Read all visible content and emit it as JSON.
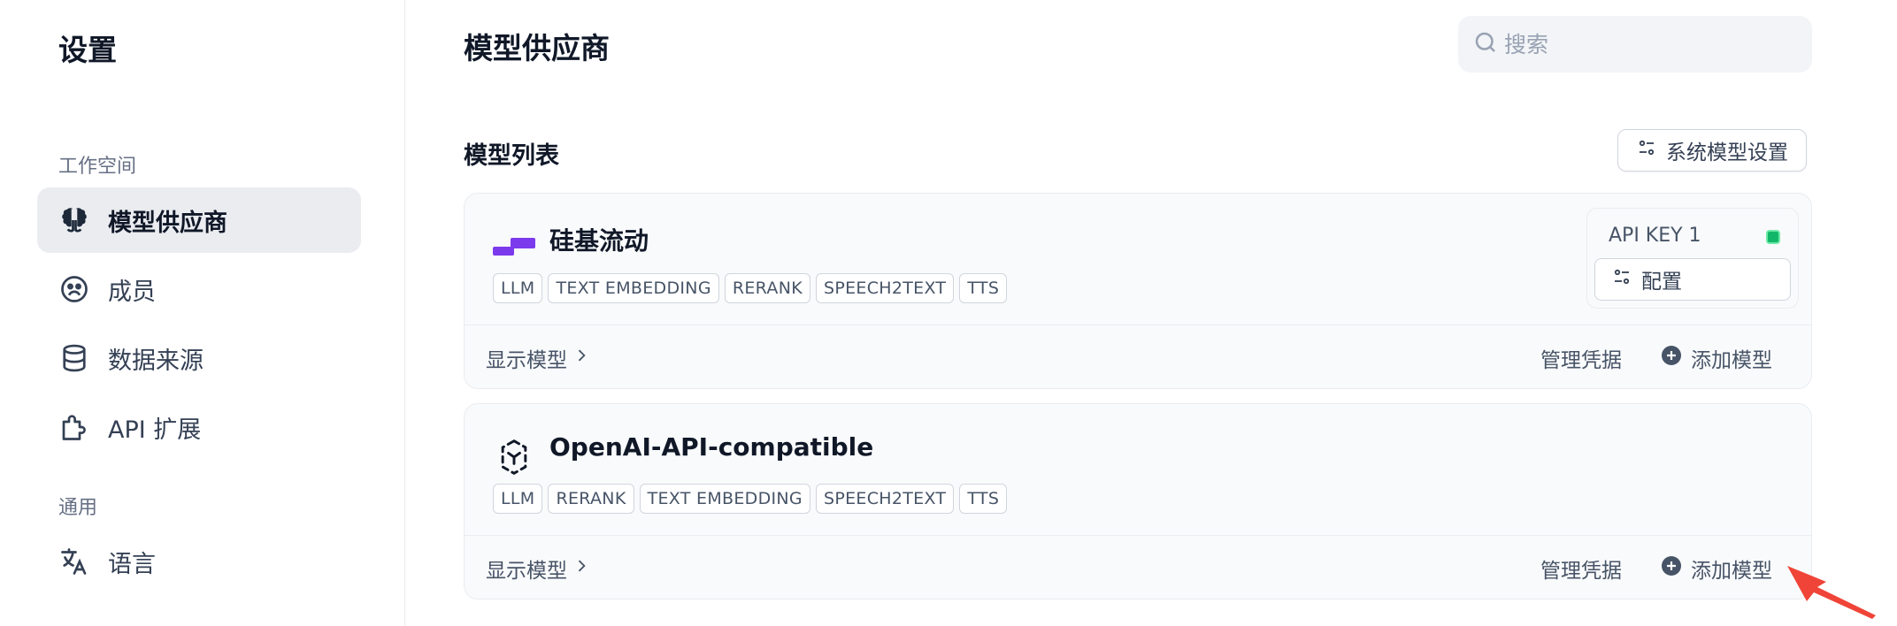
{
  "sidebar": {
    "title": "设置",
    "sections": [
      {
        "label": "工作空间",
        "items": [
          {
            "label": "模型供应商",
            "icon": "brain-icon",
            "active": true
          },
          {
            "label": "成员",
            "icon": "members-icon",
            "active": false
          },
          {
            "label": "数据来源",
            "icon": "database-icon",
            "active": false
          },
          {
            "label": "API 扩展",
            "icon": "puzzle-icon",
            "active": false
          }
        ]
      },
      {
        "label": "通用",
        "items": [
          {
            "label": "语言",
            "icon": "translate-icon",
            "active": false
          }
        ]
      }
    ]
  },
  "header": {
    "title": "模型供应商",
    "search": {
      "placeholder": "搜索",
      "value": ""
    }
  },
  "model_list": {
    "title": "模型列表",
    "system_settings_label": "系统模型设置",
    "providers": [
      {
        "name": "硅基流动",
        "logo": "siliconflow-logo-icon",
        "tags": [
          "LLM",
          "TEXT EMBEDDING",
          "RERANK",
          "SPEECH2TEXT",
          "TTS"
        ],
        "api_key_label": "API KEY 1",
        "api_key_status": "active",
        "config_label": "配置",
        "show_models_label": "显示模型",
        "manage_credentials_label": "管理凭据",
        "add_model_label": "添加模型"
      },
      {
        "name": "OpenAI-API-compatible",
        "logo": "openai-compatible-logo-icon",
        "tags": [
          "LLM",
          "RERANK",
          "TEXT EMBEDDING",
          "SPEECH2TEXT",
          "TTS"
        ],
        "show_models_label": "显示模型",
        "manage_credentials_label": "管理凭据",
        "add_model_label": "添加模型"
      }
    ]
  },
  "colors": {
    "accent": "#7c3aed",
    "status_green": "#12b76a",
    "annotation_arrow": "#f04438"
  }
}
